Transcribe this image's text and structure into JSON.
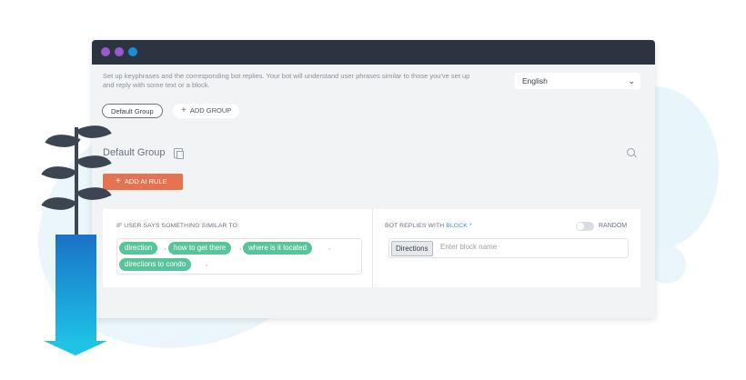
{
  "window": {
    "description": "Set up keyphrases and the corresponding bot replies. Your bot will understand user phrases similar to those you've set up and reply with some text or a block.",
    "language_selected": "English",
    "groups": [
      {
        "label": "Default Group"
      },
      {
        "label": "ADD GROUP"
      }
    ],
    "current_group_title": "Default Group",
    "add_rule_label": "ADD AI RULE",
    "rule": {
      "user_says_label": "IF USER SAYS SOMETHING SIMILAR TO:",
      "phrases": [
        "direction",
        "how to get there",
        "where is it located",
        "directions to condo"
      ],
      "bot_replies_prefix": "BOT REPLIES WITH ",
      "bot_replies_block_word": "BLOCK",
      "required_mark": "*",
      "block_chip": "Directions",
      "block_placeholder": "Enter block name",
      "random_label": "RANDOM",
      "random_on": false
    }
  },
  "colors": {
    "titlebar": "#2b3440",
    "accent_orange": "#e5734f",
    "chip_green": "#58c49a",
    "link_blue": "#3b8bd9",
    "pot_gradient_top": "#1a72c6",
    "pot_gradient_bottom": "#1ec0e6"
  },
  "icons": [
    "copy-icon",
    "search-icon",
    "chevron-down-icon",
    "plus-icon",
    "toggle-switch"
  ]
}
